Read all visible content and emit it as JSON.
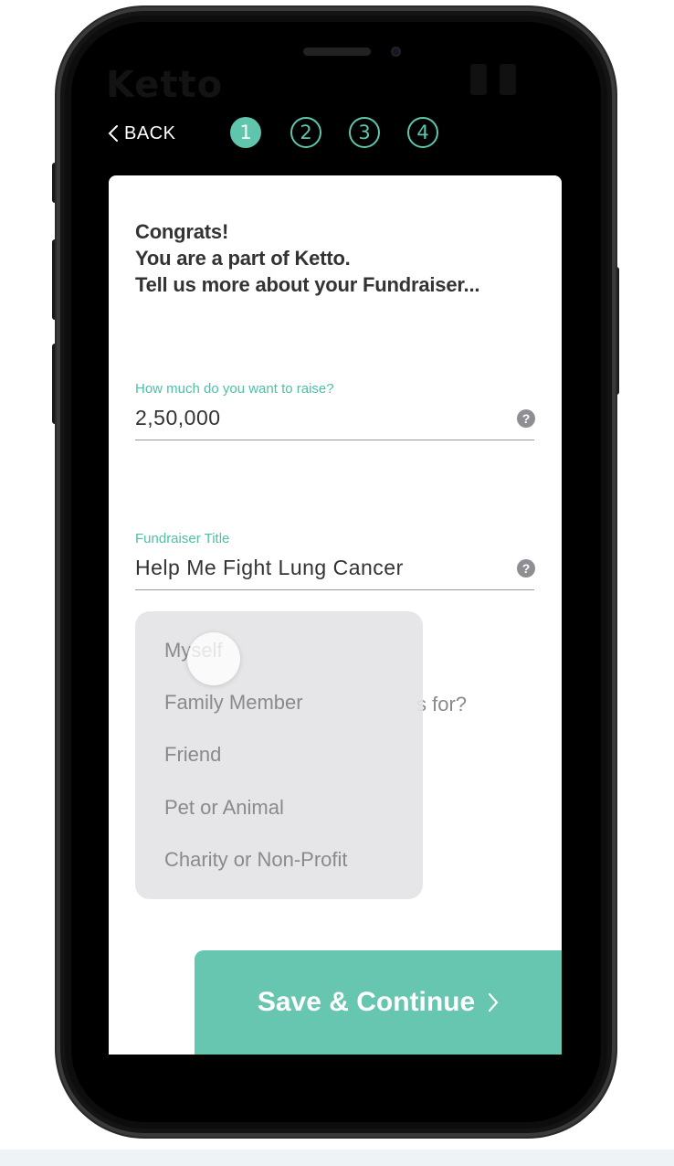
{
  "app": {
    "logo_text": "Ketto"
  },
  "nav": {
    "back_label": "BACK",
    "steps": [
      "1",
      "2",
      "3",
      "4"
    ],
    "active_step": 1
  },
  "card": {
    "heading": [
      "Congrats!",
      "You are a part of Ketto.",
      "Tell us more about your Fundraiser..."
    ],
    "amount_field": {
      "label": "How much do you want to raise?",
      "value": "2,50,000",
      "help": "?"
    },
    "title_field": {
      "label": "Fundraiser Title",
      "value": "Help Me Fight Lung Cancer",
      "help": "?"
    },
    "beneficiary_question_partial": "s for?",
    "beneficiary_options": [
      "Myself",
      "Family Member",
      "Friend",
      "Pet or Animal",
      "Charity or Non-Profit"
    ],
    "save_button_label": "Save & Continue"
  },
  "colors": {
    "accent": "#5fc6ad",
    "button": "#67c6b0",
    "text": "#333333"
  }
}
